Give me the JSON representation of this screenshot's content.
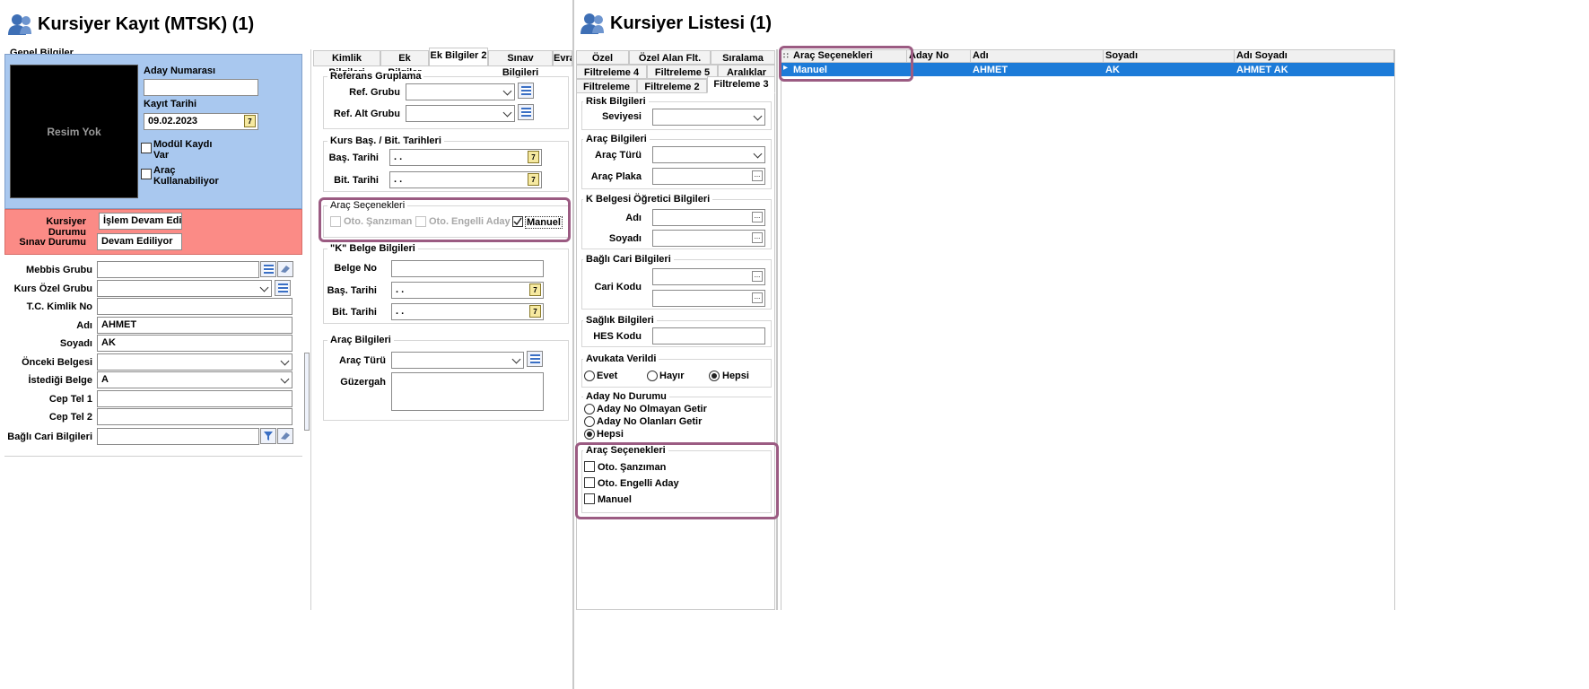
{
  "left_window": {
    "title": "Kursiyer Kayıt (MTSK) (1)",
    "genel_bilgiler": "Genel Bilgiler",
    "photo": "Resim Yok",
    "aday_numarasi_label": "Aday Numarası",
    "aday_numarasi_value": "",
    "kayit_tarihi_label": "Kayıt Tarihi",
    "kayit_tarihi_value": "09.02.2023",
    "modul_kaydi_label": "Modül Kaydı Var",
    "arac_kullanabiliyor_label": "Araç Kullanabiliyor",
    "kursiyer_durumu_label": "Kursiyer Durumu",
    "kursiyer_durumu_value": "İşlem Devam Ediy",
    "sinav_durumu_label": "Sınav Durumu",
    "sinav_durumu_value": "Devam Ediliyor",
    "fields": [
      {
        "label": "Mebbis Grubu",
        "value": ""
      },
      {
        "label": "Kurs Özel Grubu",
        "value": ""
      },
      {
        "label": "T.C. Kimlik No",
        "value": ""
      },
      {
        "label": "Adı",
        "value": "AHMET"
      },
      {
        "label": "Soyadı",
        "value": "AK"
      },
      {
        "label": "Önceki Belgesi",
        "value": ""
      },
      {
        "label": "İstediği Belge",
        "value": "A"
      },
      {
        "label": "Cep Tel 1",
        "value": ""
      },
      {
        "label": "Cep Tel 2",
        "value": ""
      },
      {
        "label": "Bağlı Cari Bilgileri",
        "value": ""
      }
    ],
    "tabs": [
      "Kimlik Bilgileri",
      "Ek Bilgiler",
      "Ek Bilgiler 2",
      "Sınav Bilgileri",
      "Evra"
    ],
    "referans": {
      "title": "Referans Gruplama",
      "ref_grubu": "Ref. Grubu",
      "ref_alt_grubu": "Ref. Alt Grubu"
    },
    "kurs_tarih": {
      "title": "Kurs Baş. / Bit. Tarihleri",
      "bas": "Baş. Tarihi",
      "bit": "Bit. Tarihi",
      "empty_date": ". ."
    },
    "arac_secenekleri": {
      "title": "Araç Seçenekleri",
      "oto_sanziman": "Oto. Şanzıman",
      "oto_engelli": "Oto. Engelli Aday",
      "manuel": "Manuel"
    },
    "k_belge": {
      "title": "\"K\" Belge Bilgileri",
      "belge_no": "Belge No",
      "bas": "Baş. Tarihi",
      "bit": "Bit. Tarihi"
    },
    "arac_bilgileri": {
      "title": "Araç Bilgileri",
      "arac_turu": "Araç Türü",
      "guzergah": "Güzergah"
    }
  },
  "right_window": {
    "title": "Kursiyer Listesi (1)",
    "tabs_row1": [
      "Özel",
      "Özel Alan Flt.",
      "Sıralama"
    ],
    "tabs_row2": [
      "Filtreleme 4",
      "Filtreleme 5",
      "Aralıklar"
    ],
    "tabs_row3": [
      "Filtreleme",
      "Filtreleme 2",
      "Filtreleme 3"
    ],
    "risk": {
      "title": "Risk Bilgileri",
      "seviyesi": "Seviyesi"
    },
    "arac": {
      "title": "Araç Bilgileri",
      "turu": "Araç Türü",
      "plaka": "Araç Plaka"
    },
    "k_ogretici": {
      "title": "K Belgesi Öğretici Bilgileri",
      "adi": "Adı",
      "soyadi": "Soyadı"
    },
    "bagli_cari": {
      "title": "Bağlı Cari Bilgileri",
      "cari_kodu": "Cari Kodu"
    },
    "saglik": {
      "title": "Sağlık Bilgileri",
      "hes": "HES Kodu"
    },
    "avukata": {
      "title": "Avukata Verildi",
      "evet": "Evet",
      "hayir": "Hayır",
      "hepsi": "Hepsi"
    },
    "aday_no": {
      "title": "Aday No Durumu",
      "olmayan": "Aday No Olmayan Getir",
      "olanlari": "Aday No Olanları Getir",
      "hepsi": "Hepsi"
    },
    "arac_sec": {
      "title": "Araç Seçenekleri",
      "oto_sanziman": "Oto. Şanzıman",
      "oto_engelli": "Oto. Engelli Aday",
      "manuel": "Manuel"
    },
    "grid": {
      "columns": [
        "Araç Seçenekleri",
        "Aday No",
        "Adı",
        "Soyadı",
        "Adı Soyadı"
      ],
      "rows": [
        [
          "Manuel",
          "",
          "AHMET",
          "AK",
          "AHMET AK"
        ]
      ]
    }
  }
}
